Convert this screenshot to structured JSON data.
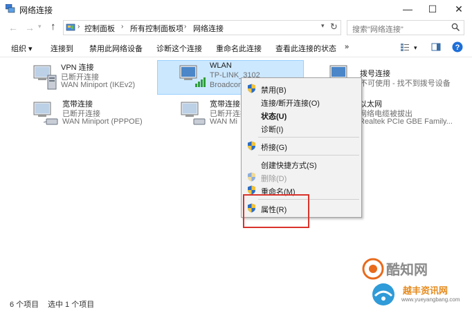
{
  "window": {
    "title": "网络连接",
    "minimize_glyph": "—",
    "maximize_glyph": "☐",
    "close_glyph": "✕"
  },
  "address": {
    "crumbs": [
      "控制面板",
      "所有控制面板项",
      "网络连接"
    ],
    "search_placeholder": "搜索\"网络连接\""
  },
  "toolbar": {
    "organize": "组织 ▾",
    "connect_to": "连接到",
    "disable_device": "禁用此网络设备",
    "diagnose": "诊断这个连接",
    "rename": "重命名此连接",
    "view_status": "查看此连接的状态",
    "more": "»"
  },
  "connections": [
    {
      "name": "VPN 连接",
      "status": "已断开连接",
      "device": "WAN Miniport (IKEv2)",
      "icon": "vpn-icon"
    },
    {
      "name": "WLAN",
      "status": "TP-LINK_3102",
      "device": "Broadcom",
      "icon": "wifi-icon"
    },
    {
      "name": "拨号连接",
      "status": "不可使用 - 找不到拨号设备",
      "device": "",
      "icon": "dialup-icon"
    },
    {
      "name": "宽带连接",
      "status": "已断开连接",
      "device": "WAN Miniport (PPPOE)",
      "icon": "broadband-icon"
    },
    {
      "name": "宽带连接",
      "status": "已断开连接",
      "device": "WAN Mi",
      "icon": "broadband-icon"
    },
    {
      "name": "以太网",
      "status": "网络电缆被拔出",
      "device": "Realtek PCIe GBE Family...",
      "icon": "ethernet-icon"
    }
  ],
  "context_menu": {
    "disable": "禁用(B)",
    "connect_disconnect": "连接/断开连接(O)",
    "status": "状态(U)",
    "diagnose": "诊断(I)",
    "bridge": "桥接(G)",
    "create_shortcut": "创建快捷方式(S)",
    "delete": "删除(D)",
    "rename": "重命名(M)",
    "properties": "属性(R)"
  },
  "statusbar": {
    "item_count": "6 个项目",
    "selected_count": "选中 1 个项目"
  },
  "watermarks": {
    "brand1": "酷知网",
    "brand2": "越丰资讯网",
    "brand2_url": "www.yueyangbang.com"
  },
  "colors": {
    "selection": "#cce8ff",
    "highlight_border": "#d9322a",
    "help_blue": "#1e6fd8",
    "wifi_green": "#2e9e3a"
  }
}
